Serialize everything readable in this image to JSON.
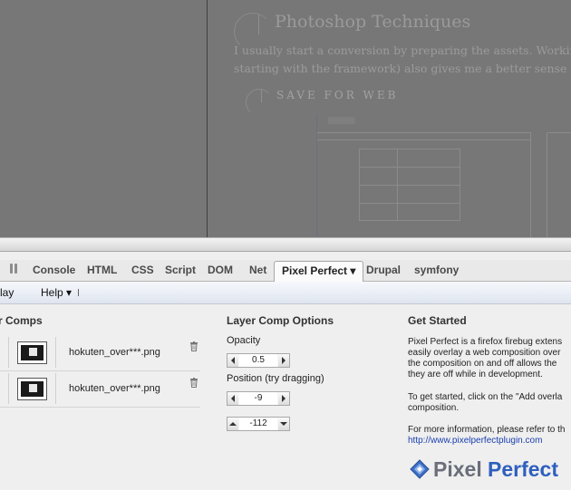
{
  "page": {
    "title": "Photoshop Techniques",
    "body_line1": "I usually start a conversion by preparing the assets. Working with the",
    "body_line2": "starting with the framework) also gives me a better sense of where",
    "subheading": "SAVE FOR WEB"
  },
  "firebug": {
    "tabs": [
      "Console",
      "HTML",
      "CSS",
      "Script",
      "DOM",
      "Net",
      "Pixel Perfect ▾",
      "Drupal",
      "symfony"
    ],
    "toolbar": {
      "overlay_label": "rlay",
      "help_label": "Help ▾"
    },
    "layer_comps": {
      "heading": "r Comps",
      "items": [
        {
          "filename": "hokuten_over***.png"
        },
        {
          "filename": "hokuten_over***.png"
        }
      ]
    },
    "options": {
      "heading": "Layer Comp Options",
      "opacity_label": "Opacity",
      "opacity_value": "0.5",
      "position_label": "Position (try dragging)",
      "position_x": "-9",
      "position_y": "-112"
    },
    "get_started": {
      "heading": "Get Started",
      "p1_line1": "Pixel Perfect is a firefox firebug extens",
      "p1_line2": "easily overlay a web composition over",
      "p1_line3": "the composition on and off allows the",
      "p1_line4": "they are off while in development.",
      "p2_line1": "To get started, click on the \"Add overla",
      "p2_line2": "composition.",
      "p3_line1": "For more information, please refer to th",
      "link": "http://www.pixelperfectplugin.com",
      "logo_word1": "Pixel",
      "logo_word2": "Perfect"
    }
  },
  "colors": {
    "accent_link": "#1a3fb0",
    "logo_blue": "#2e5fbe",
    "overlay_gray": "#777777"
  }
}
